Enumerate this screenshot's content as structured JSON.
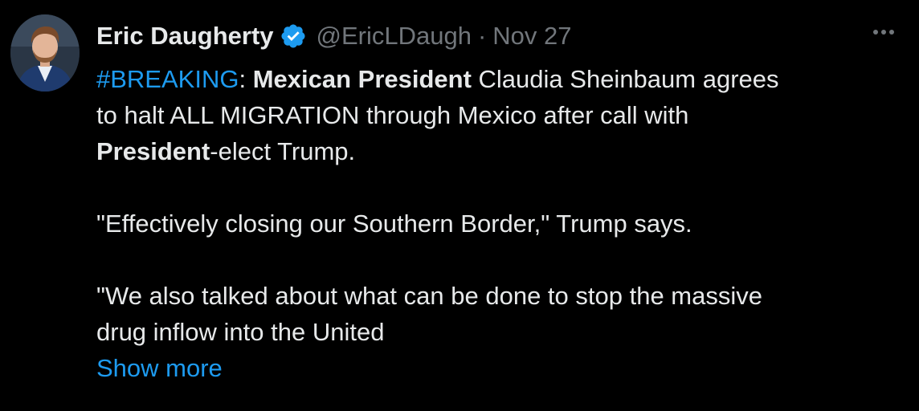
{
  "author": {
    "name": "Eric Daugherty",
    "handle": "@EricLDaugh",
    "separator": "·",
    "date": "Nov 27"
  },
  "tweet": {
    "line1": {
      "hashtag": "#BREAKING",
      "colon": ":",
      "bold1": "Mexican President",
      "rest": " Claudia Sheinbaum agrees"
    },
    "line2": "to halt ALL MIGRATION through Mexico after call with",
    "line3": {
      "bold": "President",
      "rest": "-elect Trump."
    },
    "line4": "\"Effectively closing our Southern Border,\" Trump says.",
    "line5": "\"We also talked about what can be done to stop the massive",
    "line6": "drug inflow into the United",
    "show_more": "Show more"
  },
  "icons": {
    "verified": "verified-badge-icon",
    "more": "more-dots-icon"
  },
  "colors": {
    "background": "#000000",
    "text": "#e7e9ea",
    "secondary": "#71767b",
    "accent": "#1d9bf0"
  }
}
